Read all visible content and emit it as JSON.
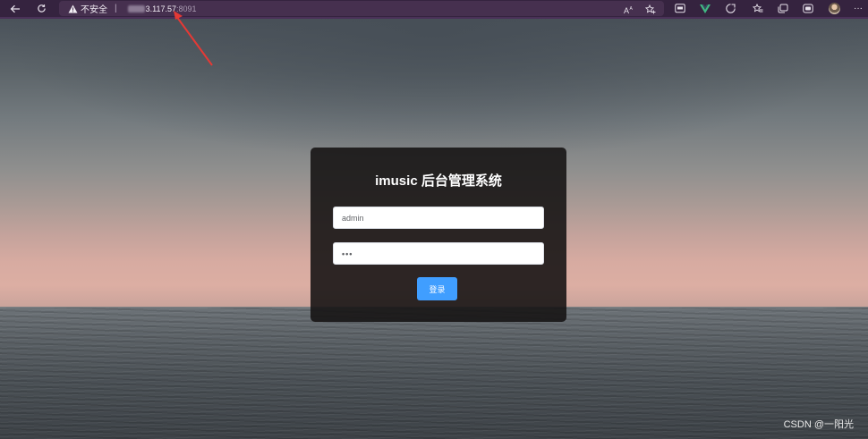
{
  "browser": {
    "security_label": "不安全",
    "separator": "|",
    "url_host": "3.117.57",
    "url_port": ":8091",
    "icons": {
      "back": "back-arrow-icon",
      "reload": "reload-icon",
      "warning": "warning-triangle-icon",
      "read_aloud": "read-aloud-icon",
      "favorite_add": "add-favorite-icon",
      "ext1": "extension-monitor-icon",
      "vue": "vue-devtools-icon",
      "ext2": "extension-icon",
      "extensions": "puzzle-icon",
      "favorites": "favorites-icon",
      "collections": "collections-icon",
      "ext3": "extension-badge-icon",
      "profile": "profile-avatar",
      "menu": "more-menu-icon"
    },
    "menu_glyph": "···"
  },
  "login": {
    "title": "imusic 后台管理系统",
    "username_value": "admin",
    "password_value": "•••",
    "submit_label": "登录"
  },
  "watermark": "CSDN @一阳光",
  "colors": {
    "accent_button": "#409eff",
    "annotation_arrow": "#e53935",
    "browser_toolbar": "#35233f"
  }
}
